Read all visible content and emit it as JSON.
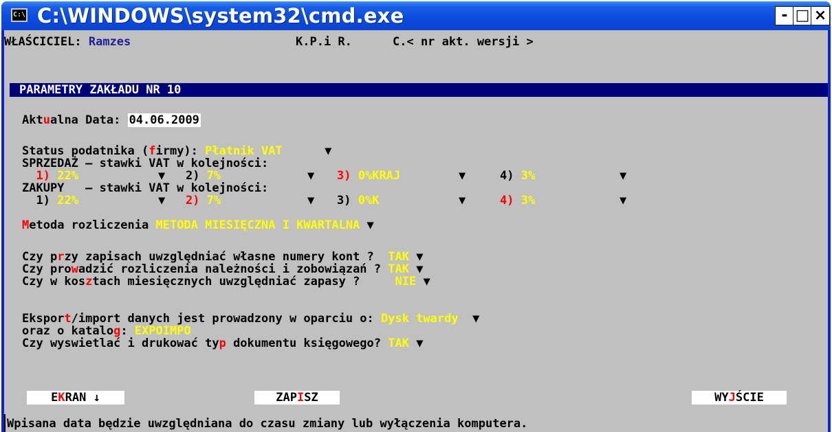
{
  "window": {
    "title": "C:\\WINDOWS\\system32\\cmd.exe",
    "icon_glyph": "C:\\",
    "controls": {
      "minimize": "-",
      "maximize": "□",
      "close": "×"
    }
  },
  "header": {
    "owner_label": "WŁAŚCICIEL:",
    "owner_name": "Ramzes",
    "kpir": "K.P.i R.",
    "version": "C.< nr akt. wersji >"
  },
  "section_title": "PARAMETRY ZAKŁADU NR 10",
  "date": {
    "label_a": "Akt",
    "label_hot": "u",
    "label_b": "alna Data: ",
    "value": "04.06.2009"
  },
  "status": {
    "label_a": "Status podatnika (",
    "label_hot": "f",
    "label_b": "irmy): ",
    "value": "Płatnik VAT     "
  },
  "sales": {
    "heading": "SPRZEDAŻ – stawki VAT w kolejności:",
    "r1_num": "1)",
    "r1_val": "22%",
    "r2_num": "2)",
    "r2_val": "7%",
    "r3_num": "3)",
    "r3_val": "0%KRAJ",
    "r4_num": "4)",
    "r4_val": "3%"
  },
  "purchases": {
    "heading": "ZAKUPY   – stawki VAT w kolejności:",
    "r1_num": "1)",
    "r1_val": "22%",
    "r2_num": "2)",
    "r2_val": "7%",
    "r3_num": "3)",
    "r3_val": "0%K",
    "r4_num": "4)",
    "r4_val": "3%"
  },
  "method": {
    "label_hot": "M",
    "label_b": "etoda rozliczenia ",
    "value": "METODA MIESIĘCZNA I KWARTALNA"
  },
  "q_accounts": {
    "a": "Czy p",
    "hot": "r",
    "b": "zy zapisach uwzględniać własne numery kont ?  ",
    "value": "TAK"
  },
  "q_settlements": {
    "a": "Czy pro",
    "hot": "w",
    "b": "adzić rozliczenia należności i zobowiązań ? ",
    "value": "TAK"
  },
  "q_stock": {
    "a": "Czy w kos",
    "hot": "z",
    "b": "tach miesięcznych uwzględniać zapasy ?     ",
    "value": "NIE"
  },
  "export": {
    "a": "Ekspor",
    "hot": "t",
    "b": "/import danych jest prowadzony w oparciu o: ",
    "value": "Dysk twardy"
  },
  "catalog": {
    "a": "oraz o katalo",
    "hot": "g",
    "b": ": ",
    "value": "EXPOIMPO"
  },
  "doc_type": {
    "a": "Czy wyswietlać i drukować ty",
    "hot": "p",
    "b": " dokumentu księgowego? ",
    "value": "TAK"
  },
  "dropdown_glyph": "▼",
  "buttons": {
    "ekran_a": "E",
    "ekran_hot": "K",
    "ekran_b": "RAN ↓",
    "zapisz_a": "ZAP",
    "zapisz_hot": "I",
    "zapisz_b": "SZ",
    "wyjscie_a": "WY",
    "wyjscie_hot": "J",
    "wyjscie_b": "ŚCIE"
  },
  "status_line": "Wpisana data będzie uwzględniana do czasu zmiany lub wyłączenia komputera.",
  "colors": {
    "console_bg": "#c0c0c0",
    "highlight_value": "#ffff00",
    "hotkey": "#ff0000",
    "section_bar": "#00007a",
    "titlebar": "#0a4ce0"
  }
}
